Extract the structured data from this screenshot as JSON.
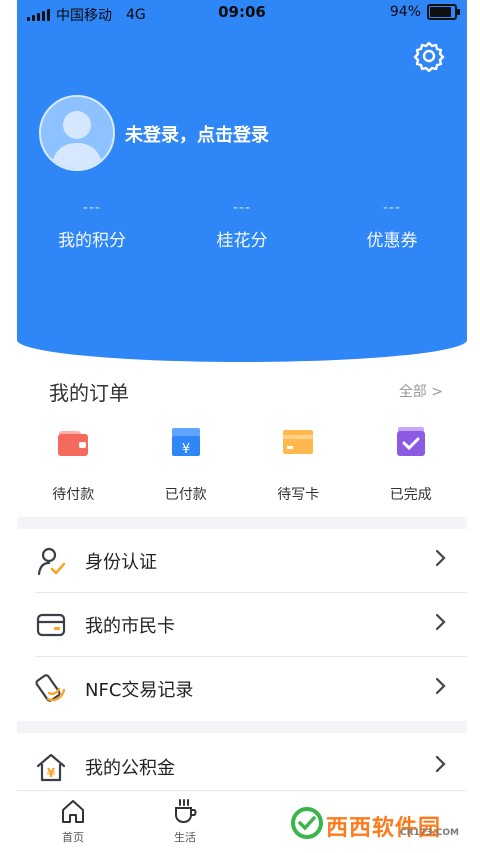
{
  "status_bar": {
    "carrier": "中国移动",
    "network": "4G",
    "time": "09:06",
    "battery": "94%",
    "battery_level": 0.94
  },
  "profile": {
    "login_prompt": "未登录，点击登录"
  },
  "stats": [
    {
      "value": "---",
      "label": "我的积分"
    },
    {
      "value": "---",
      "label": "桂花分"
    },
    {
      "value": "---",
      "label": "优惠券"
    }
  ],
  "orders": {
    "title": "我的订单",
    "all_link": "全部 >",
    "items": [
      {
        "label": "待付款",
        "icon": "wallet-icon"
      },
      {
        "label": "已付款",
        "icon": "yen-box-icon"
      },
      {
        "label": "待写卡",
        "icon": "card-icon"
      },
      {
        "label": "已完成",
        "icon": "check-icon"
      }
    ]
  },
  "menu": [
    {
      "label": "身份认证",
      "icon": "user-check-icon"
    },
    {
      "label": "我的市民卡",
      "icon": "citizen-card-icon"
    },
    {
      "label": "NFC交易记录",
      "icon": "nfc-icon"
    },
    {
      "label": "我的公积金",
      "icon": "house-fund-icon"
    }
  ],
  "tabbar": [
    {
      "label": "首页",
      "icon": "home-icon"
    },
    {
      "label": "生活",
      "icon": "coffee-icon"
    }
  ],
  "watermark": {
    "text": "西西软件园",
    "sub": "CR173.COM"
  },
  "colors": {
    "primary": "#2f86f6",
    "background": "#ffffff",
    "band": "#f2f4f7"
  }
}
